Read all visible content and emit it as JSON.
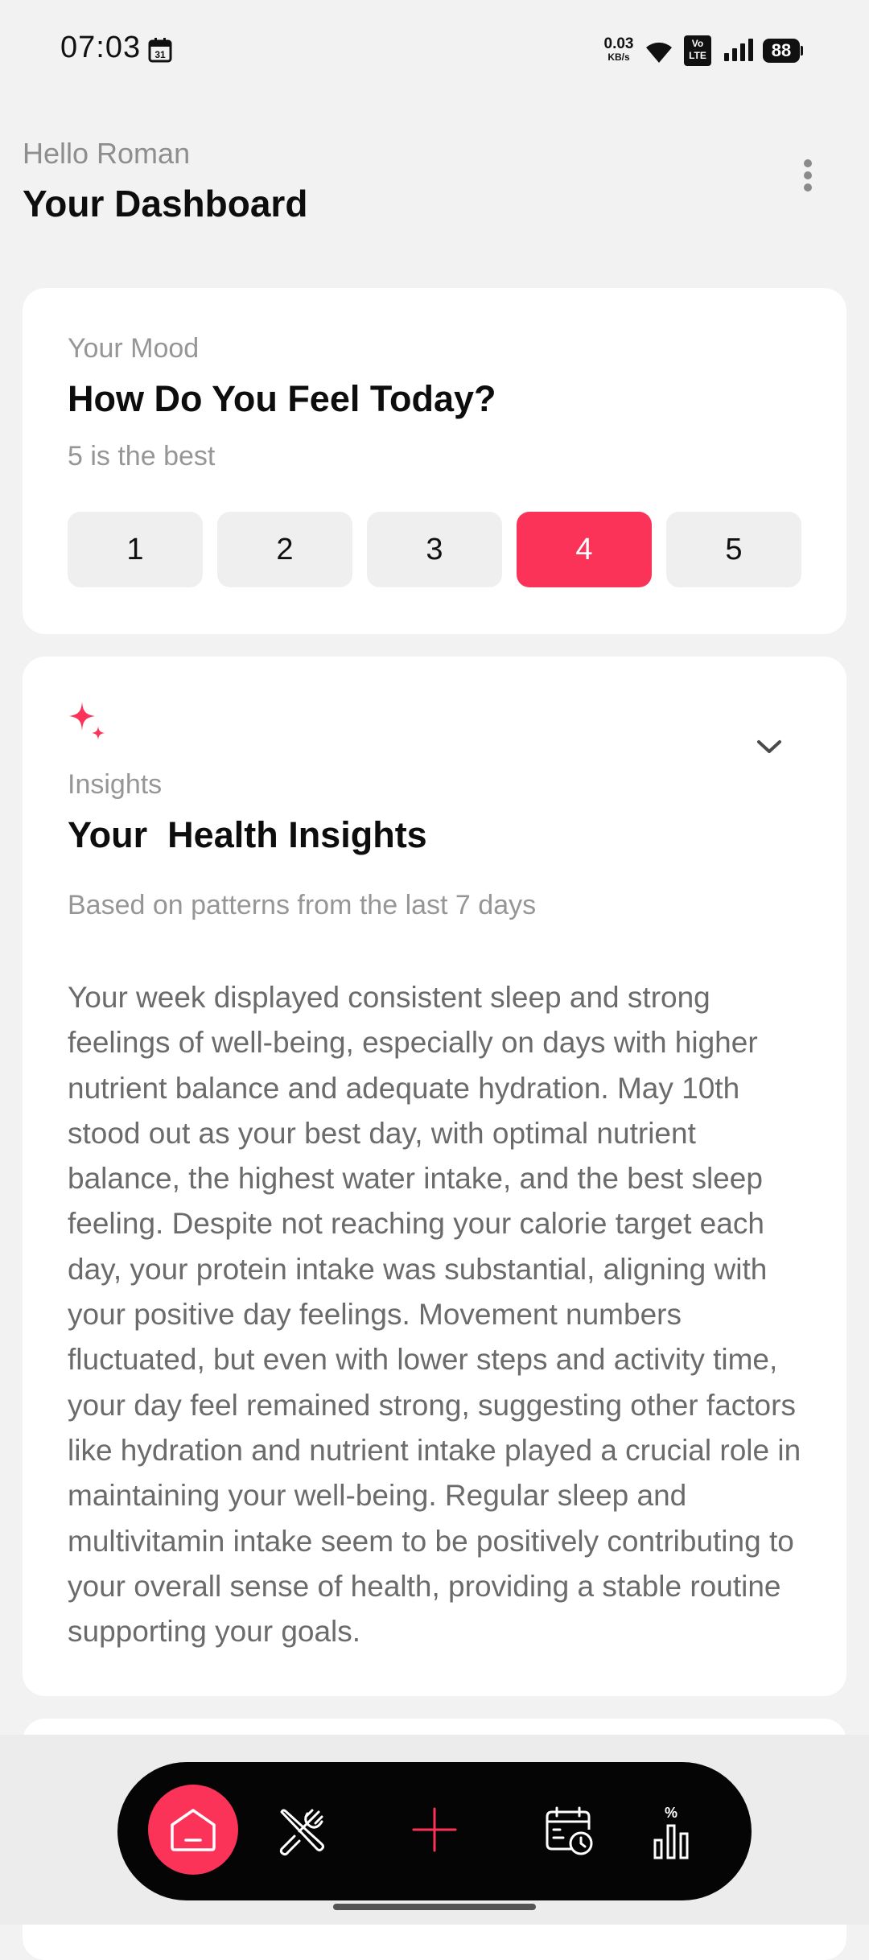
{
  "status_bar": {
    "time": "07:03",
    "net_speed": "0.03",
    "net_unit": "KB/s",
    "volte_top": "Vo",
    "volte_bottom": "LTE",
    "battery": "88"
  },
  "header": {
    "greeting": "Hello Roman",
    "title": "Your Dashboard"
  },
  "mood_card": {
    "kicker": "Your Mood",
    "title": "How Do You Feel Today?",
    "subtitle": "5 is the best",
    "options": [
      "1",
      "2",
      "3",
      "4",
      "5"
    ],
    "selected": "4"
  },
  "insights_card": {
    "kicker": "Insights",
    "title": "Your  Health Insights",
    "subtitle": "Based on patterns from the last 7 days",
    "body": "Your week displayed consistent sleep and strong feelings of well-being, especially on days with higher nutrient balance and adequate hydration. May 10th stood out as your best day, with optimal nutrient balance, the highest water intake, and the best sleep feeling. Despite not reaching your calorie target each day, your protein intake was substantial, aligning with your positive day feelings. Movement numbers fluctuated, but even with lower steps and activity time, your day feel remained strong, suggesting other factors like hydration and nutrient intake played a crucial role in maintaining your well-being. Regular sleep and multivitamin intake seem to be positively contributing to your overall sense of health, providing a stable routine supporting your goals."
  },
  "bottom_nav": {
    "items": [
      {
        "icon": "home-icon",
        "active": true
      },
      {
        "icon": "fork-knife-icon",
        "active": false
      },
      {
        "icon": "plus-icon",
        "active": false
      },
      {
        "icon": "calendar-clock-icon",
        "active": false
      },
      {
        "icon": "percent-chart-icon",
        "active": false
      }
    ]
  },
  "colors": {
    "accent": "#fb3358",
    "background": "#f2f2f2",
    "card": "#ffffff",
    "nav_bar": "#050505",
    "muted_text": "#969696"
  }
}
